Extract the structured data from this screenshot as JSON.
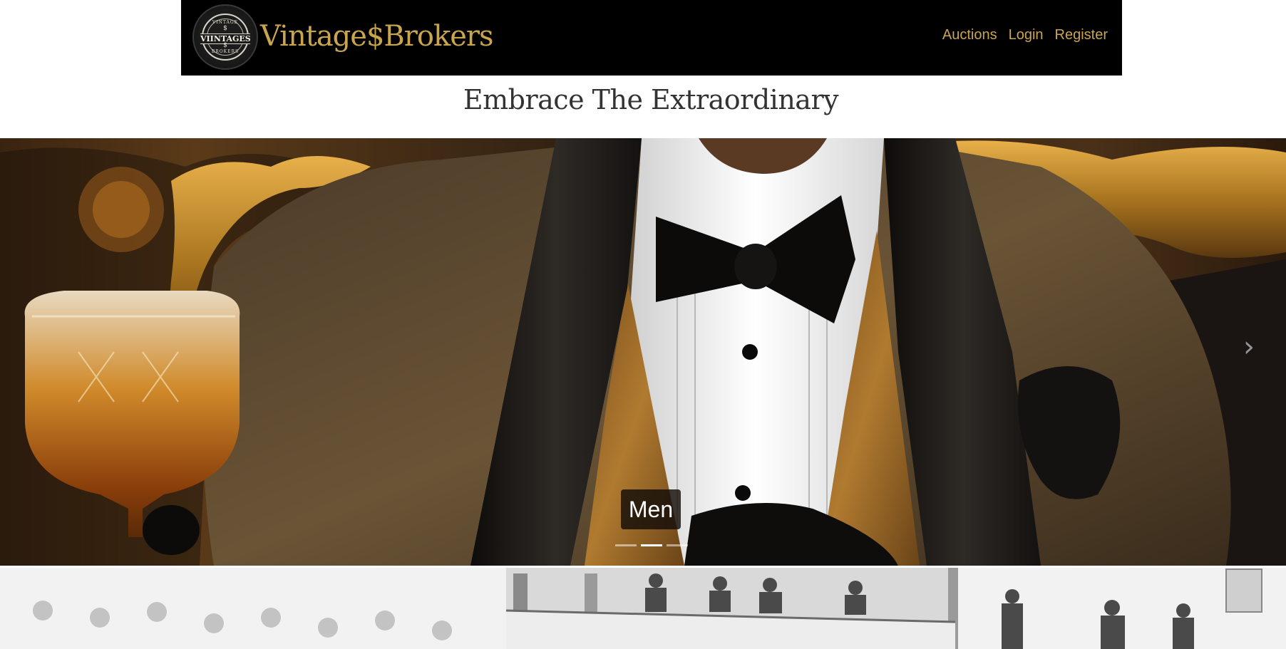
{
  "navbar": {
    "brand": "Vintage$Brokers",
    "logo": {
      "arc_top": "VINTAGE",
      "word": "VIINTAGES",
      "arc_bottom": "BROKERS",
      "dollar": "$"
    },
    "links": [
      {
        "label": "Auctions"
      },
      {
        "label": "Login"
      },
      {
        "label": "Register"
      }
    ]
  },
  "hero": {
    "headline": "Embrace The Extraordinary"
  },
  "carousel": {
    "caption": "Men",
    "slide_count": 3,
    "active_index": 1,
    "next_icon": "chevron-right-icon"
  },
  "colors": {
    "brand_gold": "#c9a54e",
    "navbar_bg": "#000000",
    "headline": "#333333"
  }
}
